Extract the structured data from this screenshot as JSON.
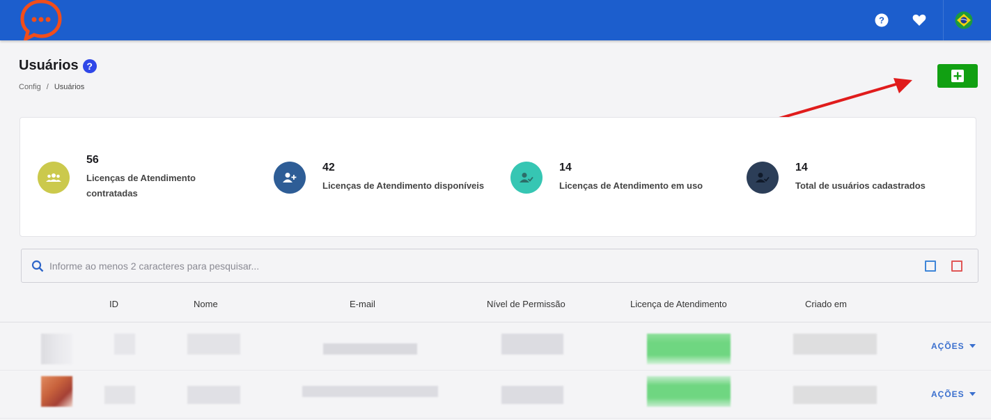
{
  "header": {
    "brand_color": "#1c5ecd",
    "logo_icon": "chat-bubble-logo",
    "icons": [
      "help-icon",
      "heart-icon",
      "brazil-flag-icon"
    ]
  },
  "page": {
    "title": "Usuários",
    "breadcrumb": [
      "Config",
      "Usuários"
    ],
    "add_button_icon": "plus-square-icon"
  },
  "stats": [
    {
      "value": "56",
      "label_line1": "Licenças de Atendimento",
      "label_line2": "contratadas",
      "icon": "group-icon",
      "color": "#cbc94c"
    },
    {
      "value": "42",
      "label_line1": "Licenças de Atendimento disponíveis",
      "label_line2": "",
      "icon": "user-add-icon",
      "color": "#2e5d96"
    },
    {
      "value": "14",
      "label_line1": "Licenças de Atendimento em uso",
      "label_line2": "",
      "icon": "user-check-icon",
      "color": "#36c6b3"
    },
    {
      "value": "14",
      "label_line1": "Total de usuários cadastrados",
      "label_line2": "",
      "icon": "user-check-icon",
      "color": "#2c3e58"
    }
  ],
  "search": {
    "placeholder": "Informe ao menos 2 caracteres para pesquisar...",
    "value": ""
  },
  "table": {
    "columns": [
      "ID",
      "Nome",
      "E-mail",
      "Nível de Permissão",
      "Licença de Atendimento",
      "Criado em"
    ],
    "actions_label": "AÇÕES"
  }
}
